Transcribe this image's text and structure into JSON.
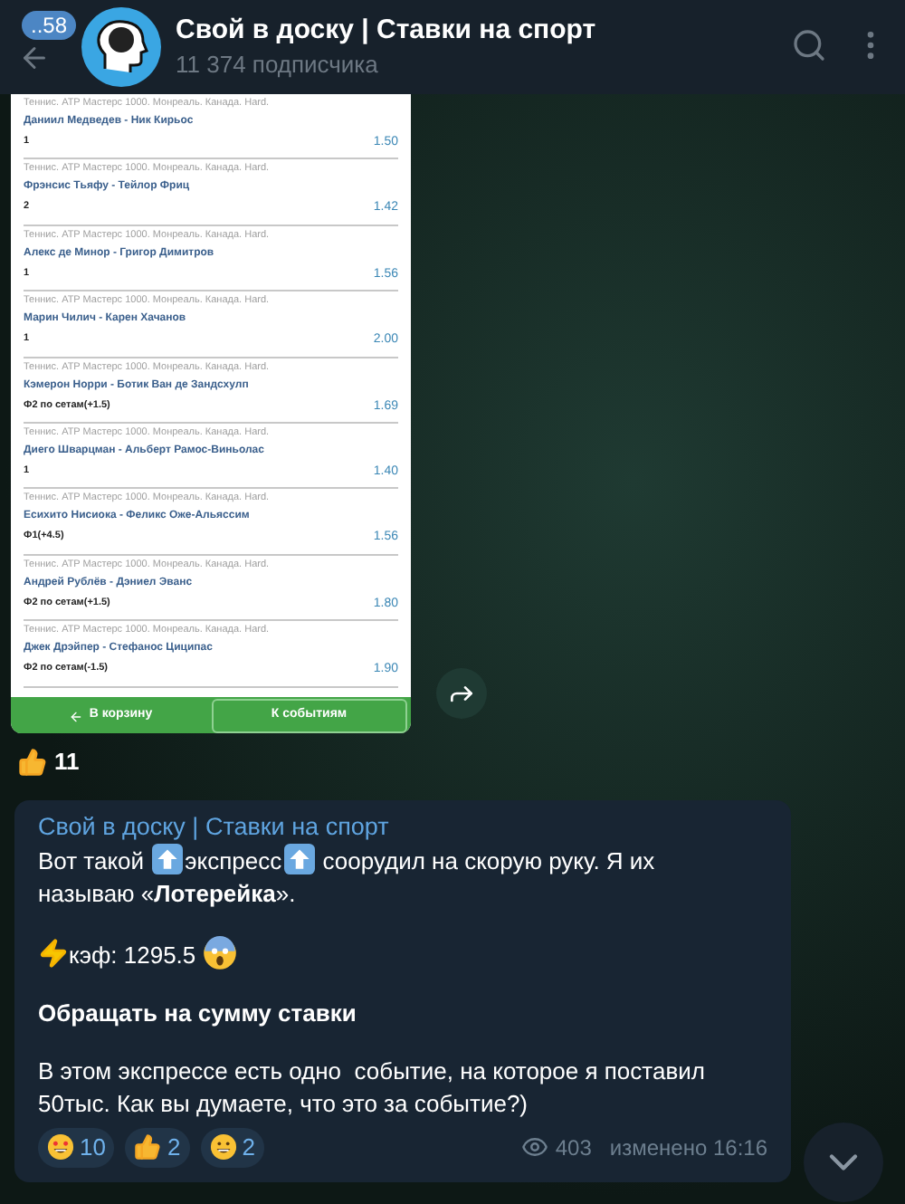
{
  "header": {
    "back_badge": "..58",
    "title": "Свой в доску | Ставки на спорт",
    "subtitle": "11 374 подписчика"
  },
  "bet_slip": {
    "events": [
      {
        "league": "Теннис. ATP Мастерс 1000. Монреаль. Канада. Hard.",
        "match": "Даниил Медведев - Ник Кирьос",
        "bet": "1",
        "odds": "1.50"
      },
      {
        "league": "Теннис. ATP Мастерс 1000. Монреаль. Канада. Hard.",
        "match": "Фрэнсис Тьяфу - Тейлор Фриц",
        "bet": "2",
        "odds": "1.42"
      },
      {
        "league": "Теннис. ATP Мастерс 1000. Монреаль. Канада. Hard.",
        "match": "Алекс де Минор - Григор Димитров",
        "bet": "1",
        "odds": "1.56"
      },
      {
        "league": "Теннис. ATP Мастерс 1000. Монреаль. Канада. Hard.",
        "match": "Марин Чилич - Карен Хачанов",
        "bet": "1",
        "odds": "2.00"
      },
      {
        "league": "Теннис. ATP Мастерс 1000. Монреаль. Канада. Hard.",
        "match": "Кэмерон Норри - Ботик Ван де Зандсхулп",
        "bet": "Ф2 по сетам(+1.5)",
        "odds": "1.69"
      },
      {
        "league": "Теннис. ATP Мастерс 1000. Монреаль. Канада. Hard.",
        "match": "Диего Шварцман - Альберт Рамос-Виньолас",
        "bet": "1",
        "odds": "1.40"
      },
      {
        "league": "Теннис. ATP Мастерс 1000. Монреаль. Канада. Hard.",
        "match": "Есихито Нисиока - Феликс Оже-Альяссим",
        "bet": "Ф1(+4.5)",
        "odds": "1.56"
      },
      {
        "league": "Теннис. ATP Мастерс 1000. Монреаль. Канада. Hard.",
        "match": "Андрей Рублёв - Дэниел Эванс",
        "bet": "Ф2 по сетам(+1.5)",
        "odds": "1.80"
      },
      {
        "league": "Теннис. ATP Мастерс 1000. Монреаль. Канада. Hard.",
        "match": "Джек Дрэйпер - Стефанос Циципас",
        "bet": "Ф2 по сетам(-1.5)",
        "odds": "1.90"
      }
    ],
    "buttons": [
      {
        "kind": "back",
        "label": "В корзину"
      },
      {
        "kind": "plain",
        "label": "К событиям"
      }
    ]
  },
  "post_reactions": [
    {
      "kind": "thumbs-up",
      "count": "11"
    }
  ],
  "message": {
    "author": "Свой в доску | Ставки на спорт",
    "paragraphs": [
      {
        "bold": false,
        "parts": [
          {
            "kind": "text",
            "text": "Вот такой "
          },
          {
            "kind": "arrow-up"
          },
          {
            "kind": "text",
            "text": "экспресс"
          },
          {
            "kind": "arrow-up"
          },
          {
            "kind": "text",
            "text": " соорудил на скорую руку. Я их"
          },
          {
            "kind": "text",
            "text": "называю «**Лотерейка**»."
          }
        ]
      },
      {
        "bold": false,
        "parts": [
          {
            "kind": "bolt"
          },
          {
            "kind": "text",
            "text": "кэф: 1295.5 "
          },
          {
            "kind": "scream"
          }
        ]
      },
      {
        "bold": true,
        "parts": [
          {
            "kind": "text",
            "text": "Обращать на сумму ставки"
          }
        ]
      },
      {
        "bold": false,
        "parts": [
          {
            "kind": "text",
            "text": "В этом экспрессе есть одно  событие, на которое я поставил 50тыс. Как вы думаете, что это за событие?)"
          }
        ]
      }
    ],
    "reactions": [
      {
        "kind": "star-struck",
        "count": "10"
      },
      {
        "kind": "thumbs-up",
        "count": "2"
      },
      {
        "kind": "grin",
        "count": "2"
      }
    ],
    "views": "403",
    "time": "изменено 16:16"
  }
}
